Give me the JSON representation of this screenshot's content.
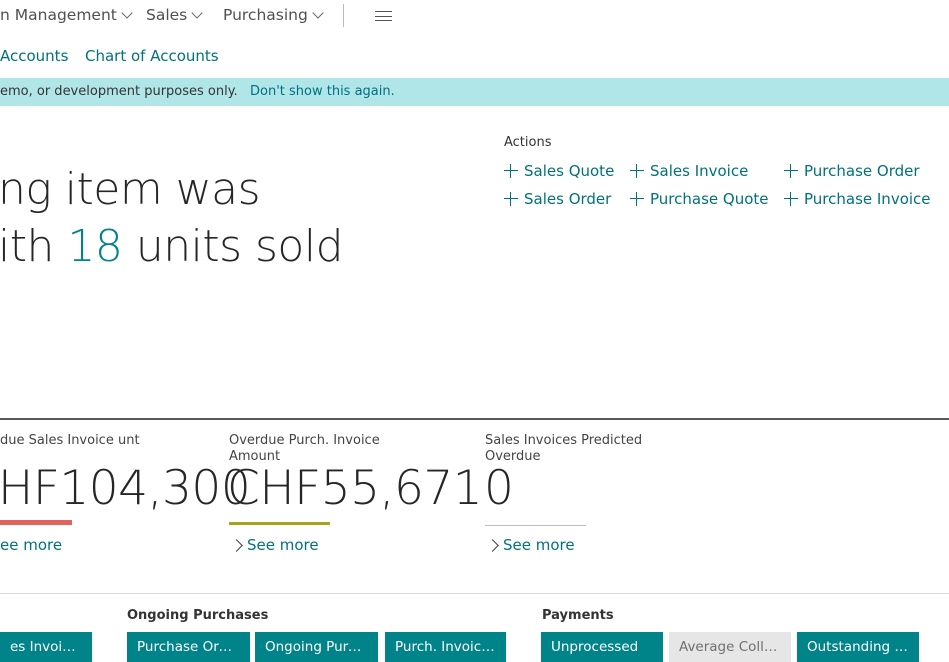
{
  "nav": {
    "items": [
      {
        "label": "n Management"
      },
      {
        "label": "Sales"
      },
      {
        "label": "Purchasing"
      }
    ]
  },
  "subnav": {
    "links": [
      "Accounts",
      "Chart of Accounts"
    ]
  },
  "banner": {
    "text": "emo, or development purposes only.",
    "link": "Don't show this again."
  },
  "headline": {
    "line1": "ng item was",
    "line2_prefix": "ith ",
    "line2_number": "18",
    "line2_suffix": " units sold"
  },
  "actions": {
    "title": "Actions",
    "items": [
      "Sales Quote",
      "Sales Invoice",
      "Purchase Order",
      "Sales Order",
      "Purchase Quote",
      "Purchase Invoice"
    ]
  },
  "kpis": [
    {
      "label": "due Sales Invoice unt",
      "value": "HF104,300",
      "bar_color": "#e0645e"
    },
    {
      "label": "Overdue Purch. Invoice Amount",
      "value": "CHF55,671",
      "bar_color": "#a8a21c"
    },
    {
      "label": "Sales Invoices Predicted Overdue",
      "value": "0",
      "bar_color": "#bdbdbd"
    }
  ],
  "see_more": [
    "ee more",
    "See more",
    "See more"
  ],
  "groups": {
    "purchases_title": "Ongoing Purchases",
    "payments_title": "Payments"
  },
  "tiles": [
    "es Invoices",
    "Purchase Orders",
    "Ongoing Purch...",
    "Purch. Invoices...",
    "Unprocessed",
    "Average Collec...",
    "Outstanding V..."
  ]
}
